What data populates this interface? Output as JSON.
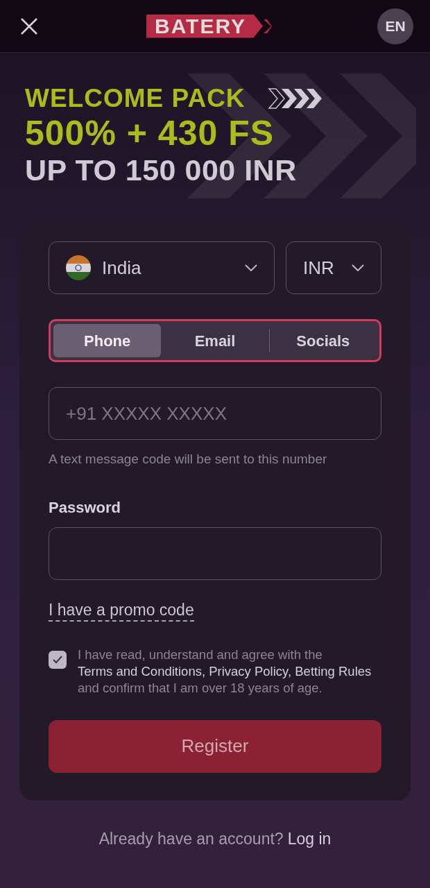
{
  "header": {
    "logo": "BATERY",
    "language": "EN"
  },
  "banner": {
    "line_1": "WELCOME PACK",
    "line_2": "500% + 430 FS",
    "line_3": "UP TO 150 000 INR"
  },
  "country": {
    "value": "India"
  },
  "currency": {
    "value": "INR"
  },
  "tabs": [
    {
      "label": "Phone",
      "selected": true
    },
    {
      "label": "Email",
      "selected": false
    },
    {
      "label": "Socials",
      "selected": false
    }
  ],
  "phone": {
    "placeholder": "+91 XXXXX XXXXX",
    "hint": "A text message code will be sent to this number"
  },
  "password": {
    "label": "Password"
  },
  "promo_link": "I have a promo code",
  "consent": {
    "checked": true,
    "parts": [
      {
        "kind": "text",
        "text": "I have read, understand and agree with the"
      },
      {
        "kind": "link",
        "text": "Terms and Conditions,"
      },
      {
        "kind": "link",
        "text": "Privacy Policy,"
      },
      {
        "kind": "link",
        "text": "Betting Rules"
      },
      {
        "kind": "text",
        "text": "and confirm that I am over 18 years of age."
      }
    ]
  },
  "register_button": "Register",
  "footer": {
    "question": "Already have an account?",
    "link": "Log in"
  }
}
